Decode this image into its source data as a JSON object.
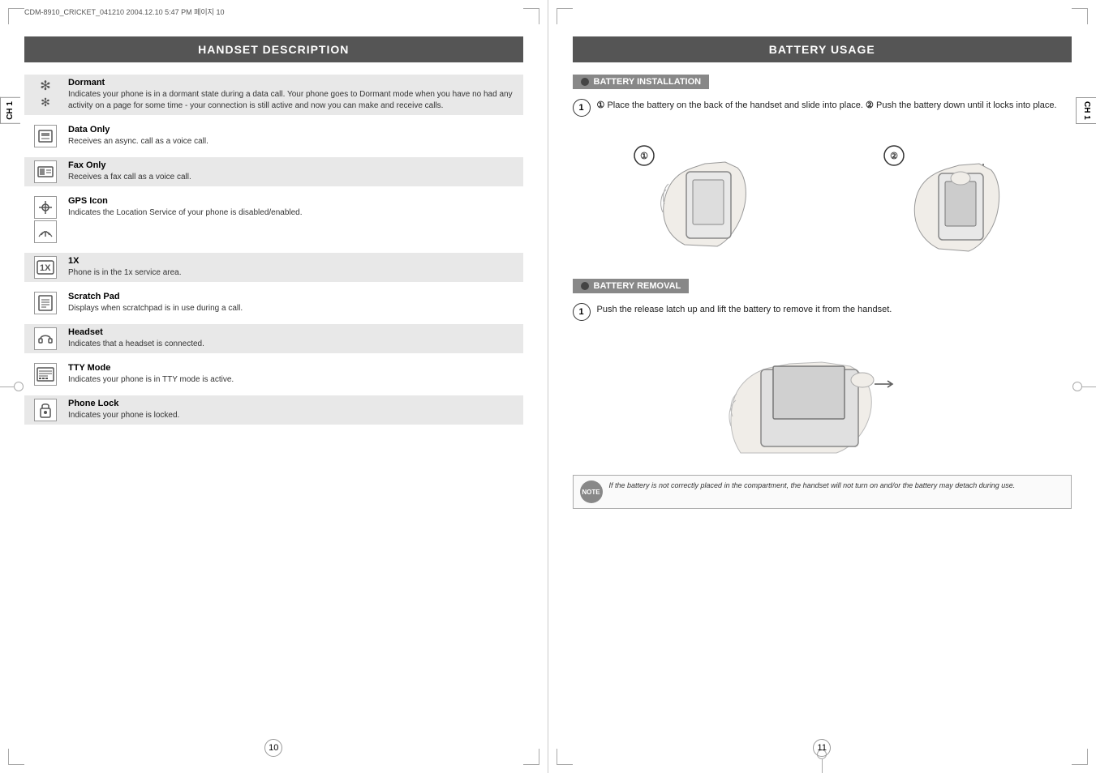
{
  "left_page": {
    "file_stamp": "CDM-8910_CRICKET_041210  2004.12.10 5:47 PM  페이지 10",
    "chapter_tab": "CH\n1",
    "header": "HANDSET DESCRIPTION",
    "page_number": "10",
    "items": [
      {
        "id": "dormant",
        "title": "Dormant",
        "desc": "Indicates your phone is in a dormant state during a data call.  Your phone goes to Dormant mode when you have no had any activity on a page for some time - your connection is still active and now you can make and receive calls.",
        "shaded": true,
        "icon_type": "dormant"
      },
      {
        "id": "data-only",
        "title": "Data Only",
        "desc": "Receives an async. call as a voice call.",
        "shaded": false,
        "icon_type": "data"
      },
      {
        "id": "fax-only",
        "title": "Fax Only",
        "desc": "Receives a fax call as a voice call.",
        "shaded": true,
        "icon_type": "fax"
      },
      {
        "id": "gps-icon",
        "title": "GPS Icon",
        "desc": "Indicates the Location Service of your phone is disabled/enabled.",
        "shaded": false,
        "icon_type": "gps"
      },
      {
        "id": "1x",
        "title": "1X",
        "desc": "Phone is in the 1x service area.",
        "shaded": true,
        "icon_type": "1x"
      },
      {
        "id": "scratch-pad",
        "title": "Scratch Pad",
        "desc": "Displays when scratchpad is in use during a call.",
        "shaded": false,
        "icon_type": "scratch"
      },
      {
        "id": "headset",
        "title": "Headset",
        "desc": "Indicates that a headset is connected.",
        "shaded": true,
        "icon_type": "headset"
      },
      {
        "id": "tty-mode",
        "title": "TTY Mode",
        "desc": "Indicates your phone is in TTY mode is active.",
        "shaded": false,
        "icon_type": "tty"
      },
      {
        "id": "phone-lock",
        "title": "Phone Lock",
        "desc": "Indicates your phone is locked.",
        "shaded": true,
        "icon_type": "lock"
      }
    ]
  },
  "right_page": {
    "chapter_tab": "CH\n1",
    "header": "BATTERY USAGE",
    "page_number": "11",
    "installation": {
      "section_title": "BATTERY INSTALLATION",
      "step1_text": "Place the battery on the back of the handset and slide into place.",
      "step1_num2": "Push the battery down until it locks into place.",
      "num1": "①",
      "num2": "②"
    },
    "removal": {
      "section_title": "BATTERY REMOVAL",
      "step1_text": "Push the release latch up and lift the battery to remove it from the handset."
    },
    "note": {
      "label": "NOTE",
      "text": "If the battery is not correctly placed in the compartment, the handset will not turn on and/or the battery may detach during use."
    }
  }
}
